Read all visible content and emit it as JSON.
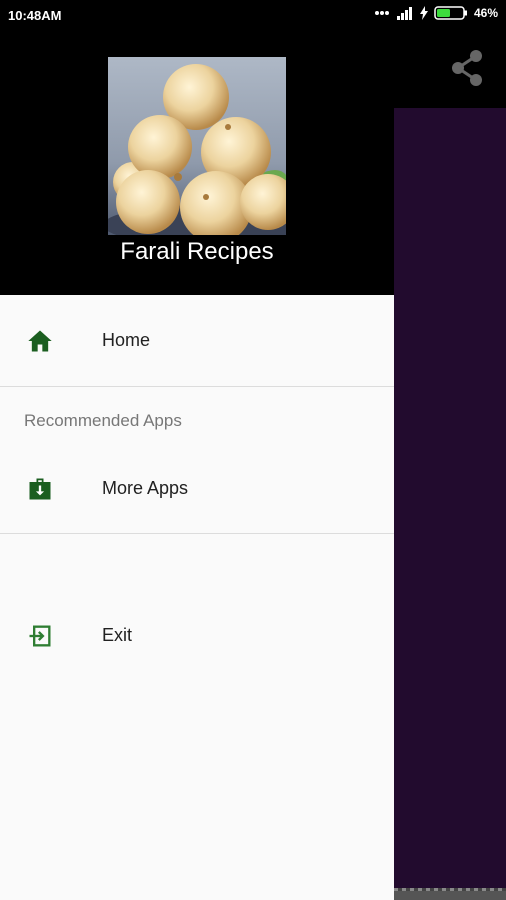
{
  "status_bar": {
    "time": "10:48AM",
    "battery": "46%"
  },
  "drawer": {
    "header_title": "Farali Recipes",
    "items": [
      {
        "label": "Home",
        "icon": "home-icon"
      },
      {
        "label": "More Apps",
        "icon": "store-icon"
      },
      {
        "label": "Exit",
        "icon": "exit-icon"
      }
    ],
    "section_header": "Recommended Apps"
  },
  "toolbar": {
    "share_icon": "share-icon"
  },
  "colors": {
    "icon_green": "#1b5e20",
    "content_purple": "#220b2e",
    "drawer_bg": "#fafafa"
  }
}
